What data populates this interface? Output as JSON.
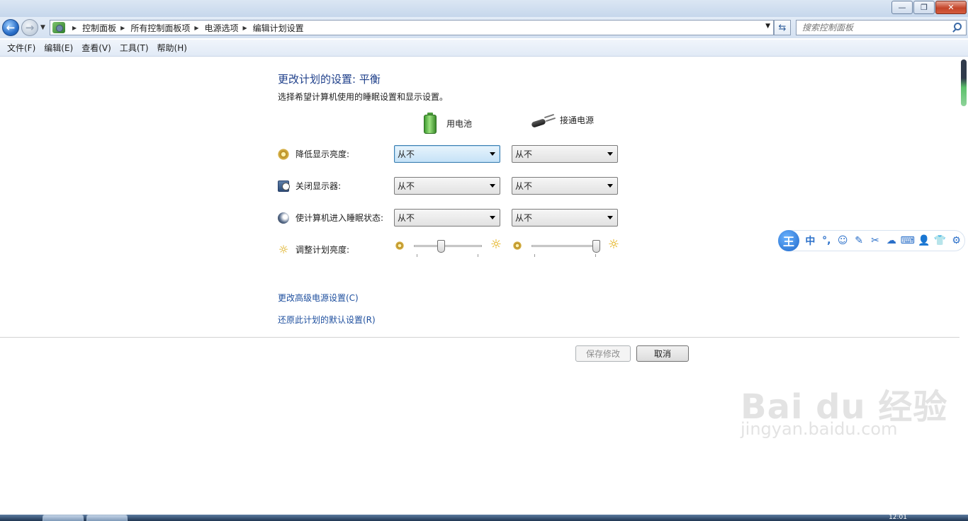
{
  "window": {
    "minimize_glyph": "—",
    "restore_glyph": "❐",
    "close_glyph": "✕"
  },
  "address": {
    "breadcrumbs": [
      "控制面板",
      "所有控制面板项",
      "电源选项",
      "编辑计划设置"
    ],
    "search_placeholder": "搜索控制面板",
    "back_glyph": "←",
    "forward_glyph": "→",
    "dropdown_glyph": "▼",
    "refresh_glyph": "⇆"
  },
  "menu": [
    "文件(F)",
    "编辑(E)",
    "查看(V)",
    "工具(T)",
    "帮助(H)"
  ],
  "main": {
    "title": "更改计划的设置: 平衡",
    "description": "选择希望计算机使用的睡眠设置和显示设置。",
    "columns": {
      "battery": "用电池",
      "plugged": "接通电源"
    },
    "settings": [
      {
        "label": "降低显示亮度:",
        "battery": "从不",
        "plugged": "从不"
      },
      {
        "label": "关闭显示器:",
        "battery": "从不",
        "plugged": "从不"
      },
      {
        "label": "使计算机进入睡眠状态:",
        "battery": "从不",
        "plugged": "从不"
      }
    ],
    "brightness": {
      "label": "调整计划亮度:",
      "battery_level": 0.4,
      "plugged_level": 0.95
    },
    "links": {
      "advanced": "更改高级电源设置(C)",
      "restore": "还原此计划的默认设置(R)"
    },
    "buttons": {
      "save": "保存修改",
      "cancel": "取消"
    }
  },
  "ime": {
    "logo": "王",
    "items": [
      "中",
      "°,",
      "☺",
      "✎",
      "✂",
      "☁",
      "⌨",
      "👤",
      "👕",
      "⚙"
    ]
  },
  "watermark": {
    "brand": "Bai du 经验",
    "url": "jingyan.baidu.com"
  },
  "taskbar": {
    "clock": "12:01"
  },
  "colors": {
    "title_blue": "#1e3f8a",
    "link_blue": "#1e4f9e",
    "focus_blue": "#3c7fb1"
  }
}
